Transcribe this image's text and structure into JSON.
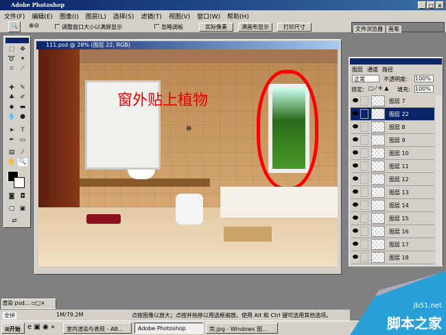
{
  "app": {
    "title": "Adobe Photoshop",
    "window_controls": [
      "_",
      "□",
      "×"
    ]
  },
  "menu": [
    "文件(F)",
    "编辑(E)",
    "图像(I)",
    "图层(L)",
    "选择(S)",
    "滤镜(T)",
    "视图(V)",
    "窗口(W)",
    "帮助(H)"
  ],
  "options": {
    "resize_windows": "调整窗口大小以满屏显示",
    "ignore_palettes": "忽略调板",
    "actual_pixels": "实际像素",
    "fit_screen": "满画布显示",
    "print_size": "打印尺寸"
  },
  "palette_well": [
    "文件浏览器",
    "画笔"
  ],
  "document": {
    "title": "111.psd @ 28% (图层 22, RGB)",
    "annotation": "窗外贴上植物"
  },
  "layers_panel": {
    "tabs": [
      "图层",
      "通道",
      "路径"
    ],
    "blend_mode": "正常",
    "opacity_label": "不透明度:",
    "opacity": "100%",
    "lock_label": "锁定:",
    "fill_label": "填充:",
    "fill": "100%",
    "layers": [
      "图层 7",
      "图层 22",
      "图层 8",
      "图层 9",
      "图层 10",
      "图层 11",
      "图层 12",
      "图层 13",
      "图层 14",
      "图层 15",
      "图层 16",
      "图层 17",
      "图层 18"
    ],
    "selected": "图层 22"
  },
  "minimized_doc": "渲染 psd...",
  "status": {
    "mode": "全拼",
    "doc_size": "1M/79.2M",
    "hint": "点按图像以放大；点按并拖移以用选框缩放。使用 Alt 和 Ctrl 键可选用其他选项。"
  },
  "taskbar": {
    "start": "开始",
    "tasks": [
      "室内渲染与表现 - AB...",
      "Adobe Photoshop",
      "完.jpg - Windows 图..."
    ]
  },
  "watermark": {
    "site": "jb51.net",
    "name": "脚本之家"
  }
}
